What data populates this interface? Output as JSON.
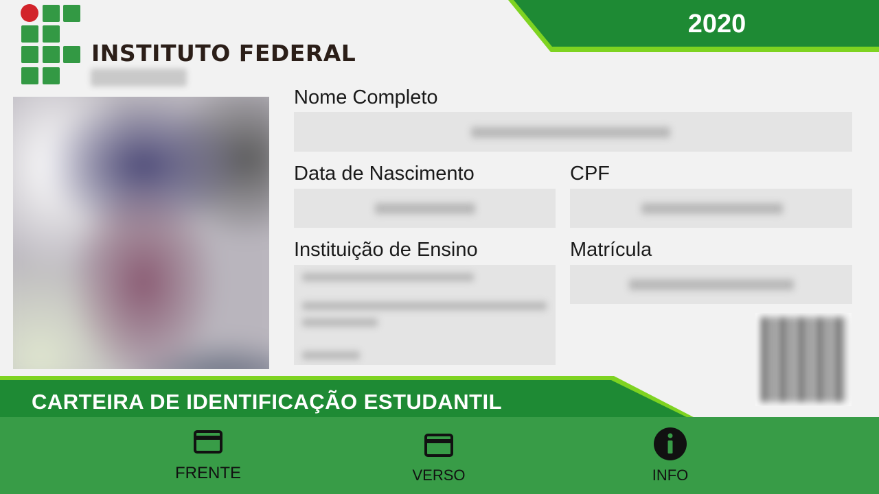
{
  "card": {
    "institution_name": "INSTITUTO FEDERAL",
    "year": "2020",
    "banner_title": "CARTEIRA DE IDENTIFICAÇÃO ESTUDANTIL",
    "fields": {
      "full_name_label": "Nome Completo",
      "birth_date_label": "Data de Nascimento",
      "cpf_label": "CPF",
      "institution_label": "Instituição de Ensino",
      "enrollment_label": "Matrícula"
    }
  },
  "nav": {
    "items": [
      {
        "label": "FRENTE",
        "icon": "card-icon"
      },
      {
        "label": "VERSO",
        "icon": "card-icon"
      },
      {
        "label": "INFO",
        "icon": "info-icon"
      }
    ]
  },
  "colors": {
    "brand_green": "#339944",
    "banner_green": "#1e8a34",
    "navbar_green": "#389c47",
    "logo_red": "#d2232a",
    "accent_lime": "#7ed321"
  }
}
